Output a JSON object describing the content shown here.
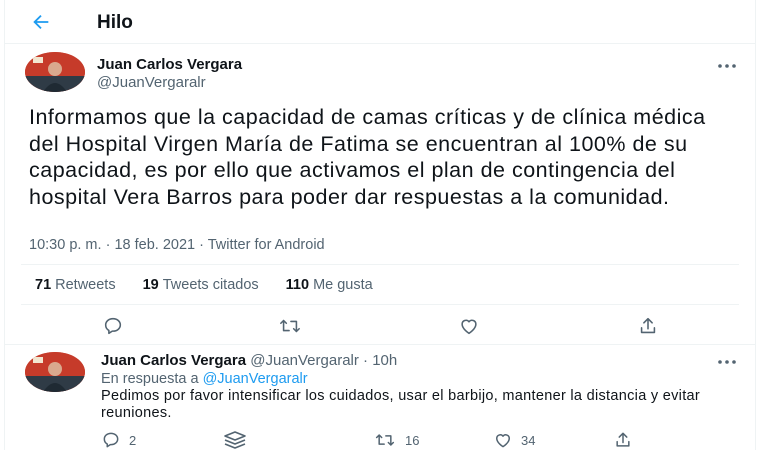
{
  "header": {
    "title": "Hilo",
    "back_icon": "arrow-left-icon"
  },
  "main_tweet": {
    "author_name": "Juan Carlos Vergara",
    "author_handle": "@JuanVergaralr",
    "text": "Informamos que la capacidad de camas críticas y de clínica médica del Hospital Virgen María de Fatima se encuentran al 100% de su capacidad, es por ello que activamos el plan de contingencia del hospital Vera Barros para poder dar respuestas a la comunidad.",
    "time": "10:30 p. m.",
    "separator": "·",
    "date": "18 feb. 2021",
    "source": "Twitter for Android",
    "stats": {
      "retweets_count": "71",
      "retweets_label": "Retweets",
      "quotes_count": "19",
      "quotes_label": "Tweets citados",
      "likes_count": "110",
      "likes_label": "Me gusta"
    }
  },
  "reply_tweet": {
    "author_name": "Juan Carlos Vergara",
    "author_handle": "@JuanVergaralr",
    "separator": "·",
    "time_ago": "10h",
    "replying_prefix": "En respuesta a",
    "replying_to": "@JuanVergaralr",
    "text": "Pedimos por favor intensificar los cuidados, usar el barbijo, mantener la distancia y evitar reuniones.",
    "reply_count": "2",
    "retweet_count": "16",
    "like_count": "34"
  },
  "colors": {
    "accent": "#1d9bf0",
    "muted": "#536471",
    "text": "#0f1419",
    "border": "#eff3f4"
  }
}
